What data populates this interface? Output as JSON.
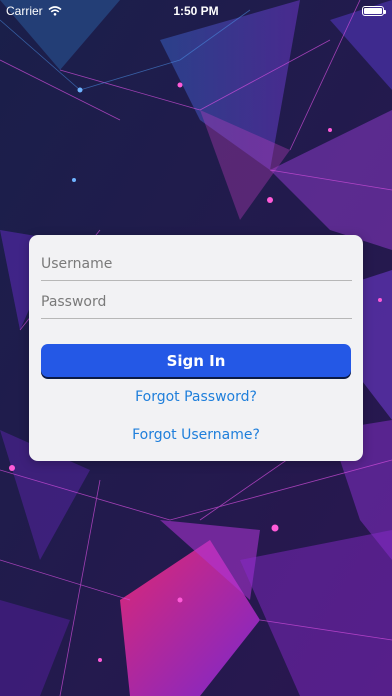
{
  "status_bar": {
    "carrier": "Carrier",
    "time": "1:50 PM",
    "battery_level": 1.0
  },
  "login": {
    "username_placeholder": "Username",
    "password_placeholder": "Password",
    "sign_in_label": "Sign In",
    "forgot_password_label": "Forgot Password?",
    "forgot_username_label": "Forgot Username?"
  },
  "colors": {
    "background": "#141733",
    "card": "#f2f2f4",
    "button": "#2458e6",
    "link": "#1f7fdb",
    "accent_magenta": "#e02a86",
    "accent_purple": "#7b3fe4"
  }
}
